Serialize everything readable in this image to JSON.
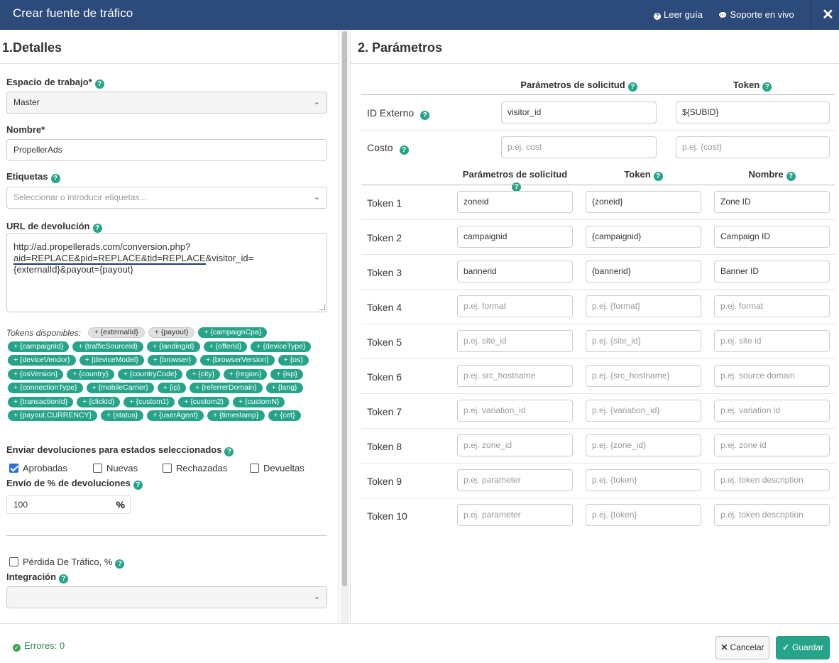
{
  "header": {
    "title": "Crear fuente de tráfico",
    "guide_label": "Leer guía",
    "support_label": "Soporte en vivo",
    "close_glyph": "✕"
  },
  "details": {
    "title": "1.Detalles",
    "workspace": {
      "label": "Espacio de trabajo*",
      "value": "Master"
    },
    "name": {
      "label": "Nombre*",
      "value": "PropellerAds"
    },
    "tags": {
      "label": "Etiquetas",
      "placeholder": "Seleccionar o introducir etiquetas..."
    },
    "postback": {
      "label": "URL de devolución",
      "line1": "http://ad.propellerads.com/conversion.php?",
      "line2_marked": "aid=REPLACE&pid=REPLACE&tid=REPLACE",
      "line2_rest": "&visitor_id=",
      "line3": "{externalId}&payout={payout}"
    },
    "tokens_label": "Tokens disponibles:",
    "tokens_grey": [
      "+ {externalId}",
      "+ {payout}"
    ],
    "tokens": [
      "+ {campaignCpa}",
      "+ {campaignId}",
      "+ {trafficSourceId}",
      "+ {landingId}",
      "+ {offerId}",
      "+ {deviceType}",
      "+ {deviceVendor}",
      "+ {deviceModel}",
      "+ {browser}",
      "+ {browserVersion}",
      "+ {os}",
      "+ {osVersion}",
      "+ {country}",
      "+ {countryCode}",
      "+ {city}",
      "+ {region}",
      "+ {isp}",
      "+ {connectionType}",
      "+ {mobileCarrier}",
      "+ {ip}",
      "+ {referrerDomain}",
      "+ {lang}",
      "+ {transactionId}",
      "+ {clickId}",
      "+ {custom1}",
      "+ {custom2}",
      "+ {customN}",
      "+ {payout.CURRENCY}",
      "+ {status}",
      "+ {userAgent}",
      "+ {timestamp}",
      "+ {cet}"
    ],
    "statuses": {
      "label": "Enviar devoluciones para estados seleccionados",
      "approved": "Aprobadas",
      "new": "Nuevas",
      "rejected": "Rechazadas",
      "returned": "Devueltas"
    },
    "percent": {
      "label": "Envío de % de devoluciones",
      "value": "100",
      "symbol": "%"
    },
    "traffic_loss": "Pérdida De Tráfico, %",
    "integration": {
      "label": "Integración",
      "value": ""
    }
  },
  "params": {
    "title": "2. Parámetros",
    "head_request": "Parámetros de solicitud",
    "head_token": "Token",
    "head_name": "Nombre",
    "external_id": {
      "label": "ID Externo",
      "param": "visitor_id",
      "token": "${SUBID}"
    },
    "cost": {
      "label": "Costo",
      "param_placeholder": "p.ej. cost",
      "token_placeholder": "p.ej. {cost}"
    },
    "rows": [
      {
        "label": "Token 1",
        "param": "zoneid",
        "token": "{zoneid}",
        "name": "Zone ID",
        "filled": true
      },
      {
        "label": "Token 2",
        "param": "campaignid",
        "token": "{campaignid}",
        "name": "Campaign ID",
        "filled": true
      },
      {
        "label": "Token 3",
        "param": "bannerid",
        "token": "{bannerid}",
        "name": "Banner ID",
        "filled": true
      },
      {
        "label": "Token 4",
        "param": "p.ej. format",
        "token": "p.ej. {format}",
        "name": "p.ej. format",
        "filled": false
      },
      {
        "label": "Token 5",
        "param": "p.ej. site_id",
        "token": "p.ej. {site_id}",
        "name": "p.ej. site id",
        "filled": false
      },
      {
        "label": "Token 6",
        "param": "p.ej. src_hostname",
        "token": "p.ej.  {src_hostname}",
        "name": "p.ej. source domain",
        "filled": false
      },
      {
        "label": "Token 7",
        "param": "p.ej. variation_id",
        "token": "p.ej. {variation_id}",
        "name": "p.ej. variation id",
        "filled": false
      },
      {
        "label": "Token 8",
        "param": "p.ej. zone_id",
        "token": "p.ej. {zone_id}",
        "name": "p.ej. zone id",
        "filled": false
      },
      {
        "label": "Token 9",
        "param": "p.ej. parameter",
        "token": "p.ej. {token}",
        "name": "p.ej. token description",
        "filled": false
      },
      {
        "label": "Token 10",
        "param": "p.ej. parameter",
        "token": "p.ej. {token}",
        "name": "p.ej. token description",
        "filled": false
      }
    ]
  },
  "footer": {
    "errors": "Errores: 0",
    "cancel": "Cancelar",
    "save": "Guardar"
  },
  "colors": {
    "header": "#2c4a7a",
    "accent": "#26a489",
    "checkbox": "#2d73d6"
  }
}
